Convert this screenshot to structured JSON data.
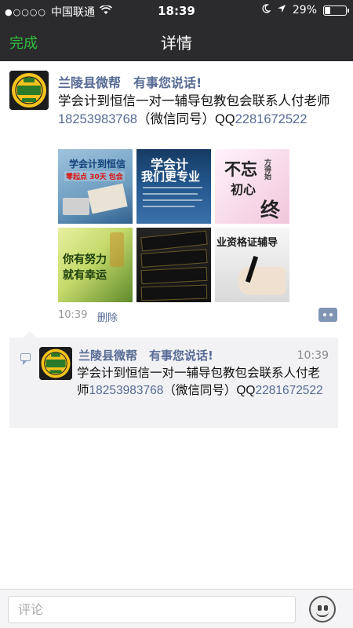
{
  "status_bar": {
    "signal": "●○○○○",
    "carrier": "中国联通",
    "time": "18:39",
    "battery": "29%",
    "battery_level": 0.29
  },
  "nav": {
    "done_label": "完成",
    "title": "详情"
  },
  "post": {
    "author": "兰陵县微帮　有事您说话!",
    "text_before_phone": "学会计到恒信一对一辅导包教包会联系人付老师",
    "phone": "18253983768",
    "text_middle": "（微信同号）QQ",
    "qq": "2281672522",
    "images": [
      {
        "name": "image-1",
        "lines": [
          "学会计到恒信",
          "零起点 30天 包会"
        ]
      },
      {
        "name": "image-2",
        "lines": [
          "学会计",
          "我们更专业"
        ]
      },
      {
        "name": "image-3",
        "lines": [
          "不忘",
          "初心",
          "方得始",
          "终"
        ]
      },
      {
        "name": "image-4",
        "lines": [
          "你有努力",
          "就有幸运"
        ]
      },
      {
        "name": "image-5",
        "lines": []
      },
      {
        "name": "image-6",
        "lines": [
          "业资格证辅导"
        ]
      }
    ],
    "time": "10:39",
    "delete_label": "删除"
  },
  "comment": {
    "author": "兰陵县微帮　有事您说话!",
    "time": "10:39",
    "text_before_phone": "学会计到恒信一对一辅导包教包会联系人付老师",
    "phone": "18253983768",
    "text_middle": "（微信同号）QQ",
    "qq": "2281672522"
  },
  "bottom_bar": {
    "placeholder": "评论"
  },
  "colors": {
    "nav_bg": "#2b2b2e",
    "accent_green": "#2fbf3d",
    "link_blue": "#576b95"
  }
}
